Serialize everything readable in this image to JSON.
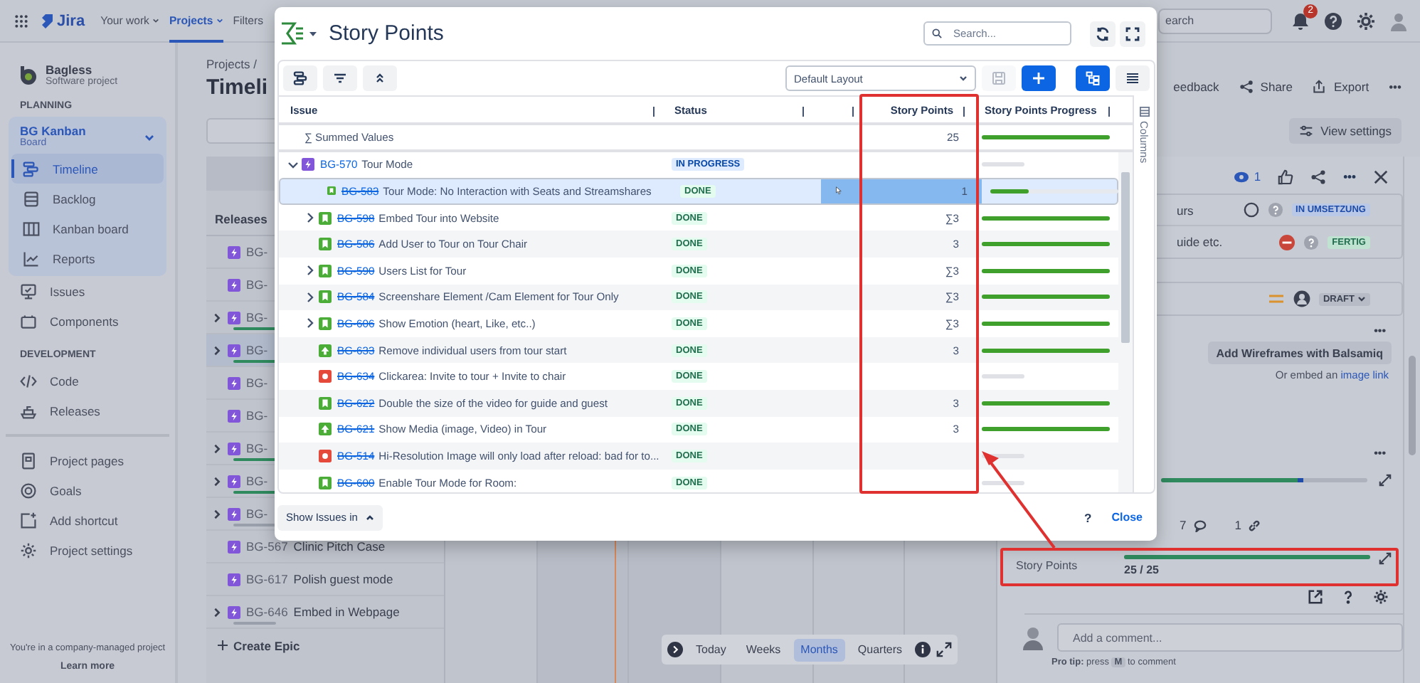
{
  "top_nav": {
    "logo": "Jira",
    "items": [
      {
        "label": "Your work",
        "selected": false
      },
      {
        "label": "Projects",
        "selected": true
      },
      {
        "label": "Filters",
        "selected": false
      }
    ],
    "search": {
      "placeholder": "earch"
    },
    "notifications": "2"
  },
  "sidebar": {
    "project": {
      "name": "Bagless",
      "type": "Software project"
    },
    "groups": [
      {
        "heading": "PLANNING",
        "board": {
          "name": "BG Kanban",
          "type": "Board",
          "items": [
            {
              "label": "Timeline",
              "selected": true
            },
            {
              "label": "Backlog",
              "selected": false
            },
            {
              "label": "Kanban board",
              "selected": false
            },
            {
              "label": "Reports",
              "selected": false
            }
          ]
        },
        "items": [
          {
            "label": "Issues",
            "selected": false
          },
          {
            "label": "Components",
            "selected": false
          }
        ]
      },
      {
        "heading": "DEVELOPMENT",
        "items": [
          {
            "label": "Code",
            "selected": false
          },
          {
            "label": "Releases",
            "selected": false
          }
        ]
      },
      {
        "items": [
          {
            "label": "Project pages",
            "selected": false
          },
          {
            "label": "Goals",
            "selected": false
          },
          {
            "label": "Add shortcut",
            "selected": false
          },
          {
            "label": "Project settings",
            "selected": false
          }
        ]
      }
    ],
    "footer": {
      "text": "You're in a company-managed project",
      "link": "Learn more"
    }
  },
  "page": {
    "breadcrumb": "Projects /",
    "title": "Timeli",
    "actions": [
      {
        "label": "eedback"
      },
      {
        "label": "Share",
        "kind": "share"
      },
      {
        "label": "Export",
        "kind": "export"
      },
      {
        "label": "•••"
      }
    ],
    "view_settings": "View settings"
  },
  "timeline": {
    "header": "Releases",
    "rows": [
      {
        "key": "BG-",
        "expandable": false,
        "selected": false
      },
      {
        "key": "BG-",
        "expandable": false,
        "selected": false
      },
      {
        "key": "BG-",
        "expandable": true,
        "color": "#2f8a5e",
        "selected": false
      },
      {
        "key": "BG-",
        "expandable": true,
        "color": "#2f8a5e",
        "selected": true
      },
      {
        "key": "BG-",
        "expandable": false,
        "selected": false
      },
      {
        "key": "BG-",
        "expandable": false,
        "selected": false
      },
      {
        "key": "BG-",
        "expandable": true,
        "color": "#2f8a5e",
        "selected": false
      },
      {
        "key": "BG-",
        "expandable": true,
        "color": "#2f8a5e",
        "selected": false
      },
      {
        "key": "BG-",
        "expandable": true,
        "color": "#9aa0ab",
        "selected": false
      },
      {
        "key": "BG-567",
        "summary": "Clinic Pitch Case",
        "expandable": false,
        "selected": false
      },
      {
        "key": "BG-617",
        "summary": "Polish guest mode",
        "expandable": false,
        "selected": false
      },
      {
        "key": "BG-646",
        "summary": "Embed in Webpage",
        "expandable": true,
        "color": "#9aa0ab",
        "selected": false
      }
    ],
    "create": "Create Epic",
    "zoom": [
      {
        "label": "Today",
        "selected": false
      },
      {
        "label": "Weeks",
        "selected": false
      },
      {
        "label": "Months",
        "selected": true
      },
      {
        "label": "Quarters",
        "selected": false
      }
    ]
  },
  "modal": {
    "title": "Story Points",
    "search": {
      "placeholder": "Search..."
    },
    "layout": "Default Layout",
    "columns": [
      {
        "label": "Issue"
      },
      {
        "label": "Status"
      },
      {},
      {
        "label": "Story Points"
      },
      {
        "label": "Story Points Progress"
      }
    ],
    "side_tab": "Columns",
    "summary_row": {
      "label": "∑ Summed Values",
      "points": "25",
      "level": 1
    },
    "rows": [
      {
        "expandable": true,
        "expanded": true,
        "kind": "epic",
        "key": "BG-570",
        "resolved": false,
        "summary": "Tour Mode",
        "status": {
          "label": "IN PROGRESS",
          "kind": "in_progress"
        },
        "selected": false,
        "children": [
          {
            "expandable": false,
            "kind": "story",
            "key": "BG-583",
            "resolved": true,
            "summary": "Tour Mode: No Interaction with Seats and Streamshares",
            "status": {
              "label": "DONE",
              "kind": "done"
            },
            "points": "1",
            "level": 0.3,
            "selected": true
          },
          {
            "expandable": true,
            "expanded": false,
            "kind": "story",
            "key": "BG-598",
            "resolved": true,
            "summary": "Embed Tour into Website",
            "status": {
              "label": "DONE",
              "kind": "done"
            },
            "points": "∑3",
            "level": 1,
            "selected": false
          },
          {
            "expandable": false,
            "kind": "story",
            "key": "BG-586",
            "resolved": true,
            "summary": "Add User to Tour on Tour Chair",
            "status": {
              "label": "DONE",
              "kind": "done"
            },
            "points": "3",
            "level": 1,
            "selected": false
          },
          {
            "expandable": true,
            "expanded": false,
            "kind": "story",
            "key": "BG-590",
            "resolved": true,
            "summary": "Users List for Tour",
            "status": {
              "label": "DONE",
              "kind": "done"
            },
            "points": "∑3",
            "level": 1,
            "selected": false
          },
          {
            "expandable": true,
            "expanded": false,
            "kind": "story",
            "key": "BG-584",
            "resolved": true,
            "summary": "Screenshare Element /Cam Element for Tour Only",
            "status": {
              "label": "DONE",
              "kind": "done"
            },
            "points": "∑3",
            "level": 1,
            "selected": false
          },
          {
            "expandable": true,
            "expanded": false,
            "kind": "story",
            "key": "BG-606",
            "resolved": true,
            "summary": "Show Emotion (heart, Like, etc..)",
            "status": {
              "label": "DONE",
              "kind": "done"
            },
            "points": "∑3",
            "level": 1,
            "selected": false
          },
          {
            "expandable": false,
            "kind": "improvement",
            "key": "BG-633",
            "resolved": true,
            "summary": "Remove individual users from tour start",
            "status": {
              "label": "DONE",
              "kind": "done"
            },
            "points": "3",
            "level": 1,
            "selected": false
          },
          {
            "expandable": false,
            "kind": "bug",
            "key": "BG-634",
            "resolved": true,
            "summary": "Clickarea: Invite to tour + Invite to chair",
            "status": {
              "label": "DONE",
              "kind": "done"
            },
            "selected": false
          },
          {
            "expandable": false,
            "kind": "story",
            "key": "BG-622",
            "resolved": true,
            "summary": "Double the size of the video for guide and guest",
            "status": {
              "label": "DONE",
              "kind": "done"
            },
            "points": "3",
            "level": 1,
            "selected": false
          },
          {
            "expandable": false,
            "kind": "improvement",
            "key": "BG-621",
            "resolved": true,
            "summary": "Show Media (image, Video) in Tour",
            "status": {
              "label": "DONE",
              "kind": "done"
            },
            "points": "3",
            "level": 1,
            "selected": false
          },
          {
            "expandable": false,
            "kind": "bug",
            "key": "BG-514",
            "resolved": true,
            "summary": "Hi-Resolution Image will only load after reload: bad for to...",
            "status": {
              "label": "DONE",
              "kind": "done"
            },
            "selected": false
          },
          {
            "expandable": false,
            "kind": "story",
            "key": "BG-600",
            "resolved": true,
            "summary": "Enable Tour Mode for Room:",
            "status": {
              "label": "DONE",
              "kind": "done"
            },
            "selected": false
          }
        ]
      }
    ],
    "show_issues": "Show Issues in",
    "help": "?",
    "close": "Close"
  },
  "issue_panel": {
    "watchers": "1",
    "more": "•••",
    "child_issues": [
      {
        "summary": "urs",
        "kind": "open",
        "status": {
          "label": "IN UMSETZUNG",
          "kind": "in_progress"
        }
      },
      {
        "summary": "uide etc.",
        "kind": "blocked",
        "status": {
          "label": "FERTIG",
          "kind": "done"
        }
      }
    ],
    "draft": "DRAFT",
    "more_2": "•••",
    "add_button": "Add Wireframes with Balsamiq",
    "embed": {
      "text": "Or embed an",
      "link": "image link"
    },
    "more_3": "•••",
    "progress": [
      {
        "kind": "done",
        "level": 0.66
      },
      {
        "kind": "in_progress",
        "level": 0.03
      }
    ],
    "counts": [
      {
        "value": "7",
        "kind": "comment"
      },
      {
        "value": "1",
        "kind": "link"
      }
    ],
    "story_points": {
      "label": "Story Points",
      "level": 1,
      "value": "25 / 25"
    },
    "comment": {
      "placeholder": "Add a comment..."
    },
    "pro_tip": {
      "before": "**Pro tip:** press",
      "key": "M",
      "after": "to comment"
    }
  }
}
